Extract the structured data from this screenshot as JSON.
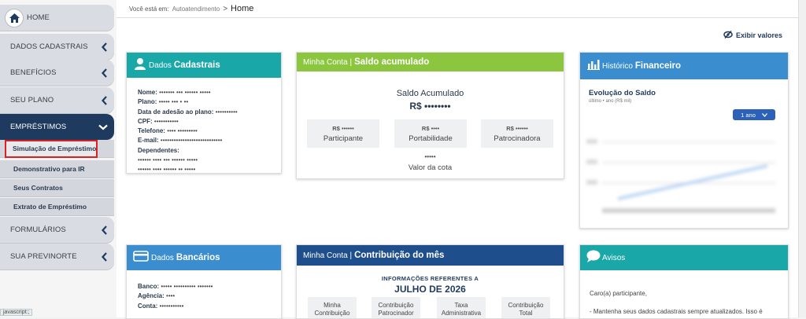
{
  "sidebar": {
    "home": "HOME",
    "items": [
      {
        "label": "DADOS CADASTRAIS"
      },
      {
        "label": "BENEFÍCIOS"
      },
      {
        "label": "SEU PLANO"
      },
      {
        "label": "EMPRÉSTIMOS"
      },
      {
        "label": "FORMULÁRIOS"
      },
      {
        "label": "SUA PREVINORTE"
      }
    ],
    "subitems": [
      {
        "label": "Simulação de Empréstimo"
      },
      {
        "label": "Demonstrativo para IR"
      },
      {
        "label": "Seus Contratos"
      },
      {
        "label": "Extrato de Empréstimo"
      }
    ]
  },
  "status_bar": "javascript:;",
  "breadcrumb": {
    "prefix": "Você está em:",
    "section": "Autoatendimento",
    "separator": ">",
    "current": "Home"
  },
  "toggle_values": "Exibir valores",
  "dados_cadastrais": {
    "title": "Dados Cadastrais",
    "color": "#1aa7a8",
    "fields": [
      {
        "label": "Nome:",
        "value": "••••••• ••• •••••• •••••"
      },
      {
        "label": "Plano:",
        "value": "••••• ••• • ••"
      },
      {
        "label": "Data de adesão ao plano:",
        "value": "••••••••••"
      },
      {
        "label": "CPF:",
        "value": "•••••••••••"
      },
      {
        "label": "Telefone:",
        "value": "•••• •••••••••"
      },
      {
        "label": "E-mail:",
        "value": "••••••••••••••••••••••••••••"
      },
      {
        "label": "Dependentes:",
        "value": ""
      }
    ],
    "dependents": [
      "•••••• •••• ••• •••••• •••••",
      "•••••• •••• •••••• •• •••••"
    ]
  },
  "saldo": {
    "prefix": "Minha Conta |",
    "title": "Saldo acumulado",
    "color": "#8cc63f",
    "heading": "Saldo Acumulado",
    "total": "R$ ••••••••",
    "boxes": [
      {
        "value": "R$ ••••••",
        "label": "Participante"
      },
      {
        "value": "R$ ••••",
        "label": "Portabilidade"
      },
      {
        "value": "R$ ••••••",
        "label": "Patrocinadora"
      }
    ],
    "quota_value": "•••••",
    "quota_label": "Valor da cota"
  },
  "historico": {
    "title_prefix": "Histórico",
    "title": "Financeiro",
    "color": "#3a8dcf",
    "chart_title": "Evolução do Saldo",
    "chart_subtitle": "último • ano (R$ mil)",
    "period": "1 ano"
  },
  "dados_bancarios": {
    "title_prefix": "Dados",
    "title": "Bancários",
    "color": "#3a8dcf",
    "fields": [
      {
        "label": "Banco:",
        "value": "••••• •••••••••• •••••••"
      },
      {
        "label": "Agência:",
        "value": "••••"
      },
      {
        "label": "Conta:",
        "value": "•••••••••••"
      }
    ]
  },
  "contribuicao": {
    "prefix": "Minha Conta |",
    "title": "Contribuição do mês",
    "color": "#1f4e8c",
    "info": "INFORMAÇÕES REFERENTES A",
    "month": "JULHO DE 2026",
    "boxes": [
      "Minha Contribuição",
      "Contribuição Patrocinador",
      "Taxa Administrativa",
      "Contribuição Total"
    ]
  },
  "avisos": {
    "title": "Avisos",
    "color": "#1aa7a8",
    "greeting": "Caro(a) participante,",
    "line1": "- Mantenha seus dados cadastrais sempre atualizados. Isso é"
  }
}
